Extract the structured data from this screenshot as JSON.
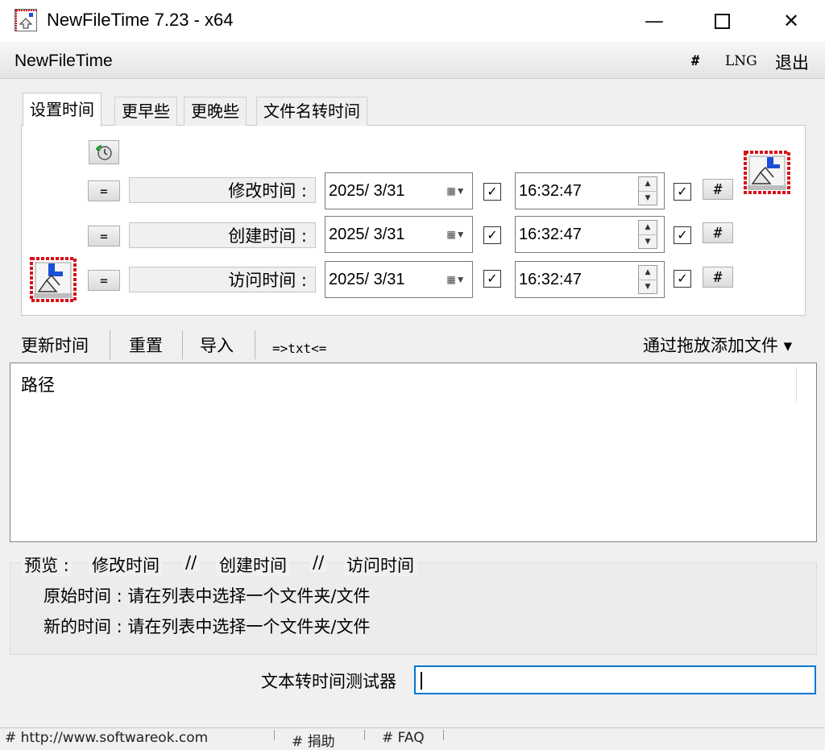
{
  "window": {
    "title": "NewFileTime 7.23 - x64",
    "min_glyph": "—",
    "close_glyph": "✕"
  },
  "menubar": {
    "app_name": "NewFileTime",
    "hash": "#",
    "lng": "LNG",
    "exit": "退出"
  },
  "tabs": [
    {
      "label": "设置时间",
      "active": true
    },
    {
      "label": "更早些",
      "active": false
    },
    {
      "label": "更晚些",
      "active": false
    },
    {
      "label": "文件名转时间",
      "active": false
    }
  ],
  "time_rows": [
    {
      "eq": "=",
      "label": "修改时间 :",
      "date": "2025/  3/31",
      "date_checked": true,
      "time": "16:32:47",
      "time_checked": true,
      "hash": "#"
    },
    {
      "eq": "=",
      "label": "创建时间 :",
      "date": "2025/  3/31",
      "date_checked": true,
      "time": "16:32:47",
      "time_checked": true,
      "hash": "#"
    },
    {
      "eq": "=",
      "label": "访问时间 :",
      "date": "2025/  3/31",
      "date_checked": true,
      "time": "16:32:47",
      "time_checked": true,
      "hash": "#"
    }
  ],
  "toolbar": {
    "update": "更新时间",
    "reset": "重置",
    "import": "导入",
    "txt": "=>txt<=",
    "drag_add": "通过拖放添加文件 ▾"
  },
  "list": {
    "column_path": "路径"
  },
  "preview": {
    "label": "预览 :",
    "modify": "修改时间",
    "sep": "//",
    "create": "创建时间",
    "access": "访问时间",
    "original_line": "原始时间 : 请在列表中选择一个文件夹/文件",
    "new_line": "新的时间 : 请在列表中选择一个文件夹/文件"
  },
  "tester": {
    "label": "文本转时间测试器",
    "value": ""
  },
  "statusbar": {
    "seg1": "# http://www.softwareok.com",
    "seg2": "# 捐助",
    "seg3": "# FAQ"
  },
  "colors": {
    "accent": "#0078d7",
    "icon_red": "#d8101a",
    "icon_blue": "#1a4fd8"
  }
}
